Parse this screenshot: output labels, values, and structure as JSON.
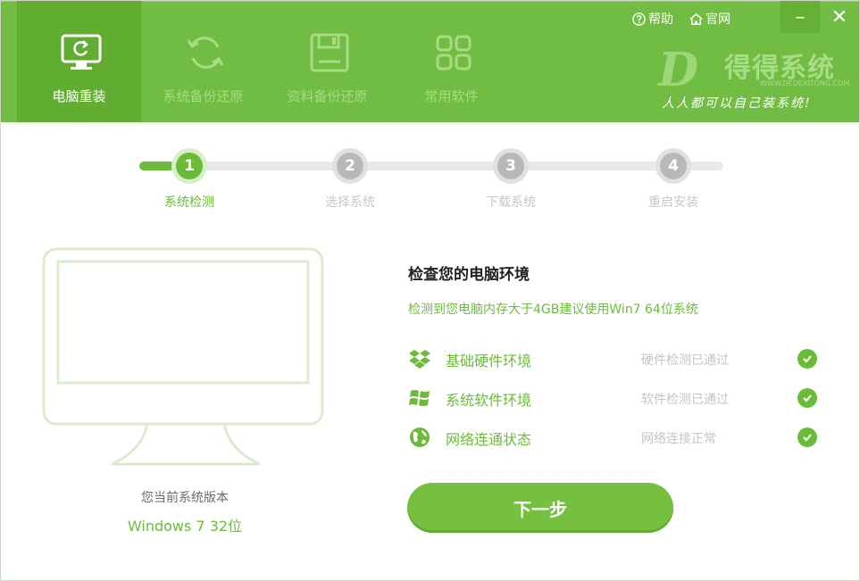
{
  "header": {
    "nav": [
      {
        "label": "电脑重装",
        "icon": "monitor-refresh-icon",
        "active": true
      },
      {
        "label": "系统备份还原",
        "icon": "refresh-icon",
        "active": false
      },
      {
        "label": "资料备份还原",
        "icon": "floppy-disk-icon",
        "active": false
      },
      {
        "label": "常用软件",
        "icon": "apps-grid-icon",
        "active": false
      }
    ],
    "help_label": "帮助",
    "site_label": "官网",
    "minimize": "–",
    "close": "✕",
    "brand": {
      "mark": "D",
      "name": "得得系统",
      "url": "WWW.DEDEXITONG.COM",
      "slogan": "人人都可以自己装系统!"
    }
  },
  "steps": {
    "items": [
      {
        "number": "1",
        "label": "系统检测",
        "active": true
      },
      {
        "number": "2",
        "label": "选择系统",
        "active": false
      },
      {
        "number": "3",
        "label": "下载系统",
        "active": false
      },
      {
        "number": "4",
        "label": "重启安装",
        "active": false
      }
    ],
    "progress": 0.06
  },
  "current_system": {
    "caption": "您当前系统版本",
    "value": "Windows 7 32位"
  },
  "check": {
    "title": "检查您的电脑环境",
    "subtitle": "检测到您电脑内存大于4GB建议使用Win7 64位系统",
    "rows": [
      {
        "name": "基础硬件环境",
        "status": "硬件检测已通过",
        "icon": "dropbox-icon"
      },
      {
        "name": "系统软件环境",
        "status": "软件检测已通过",
        "icon": "windows-icon"
      },
      {
        "name": "网络连通状态",
        "status": "网络连接正常",
        "icon": "globe-icon"
      }
    ]
  },
  "next_button": "下一步",
  "colors": {
    "accent": "#71bc43",
    "active_nav": "#61ad32",
    "muted": "#c4c4c4"
  }
}
